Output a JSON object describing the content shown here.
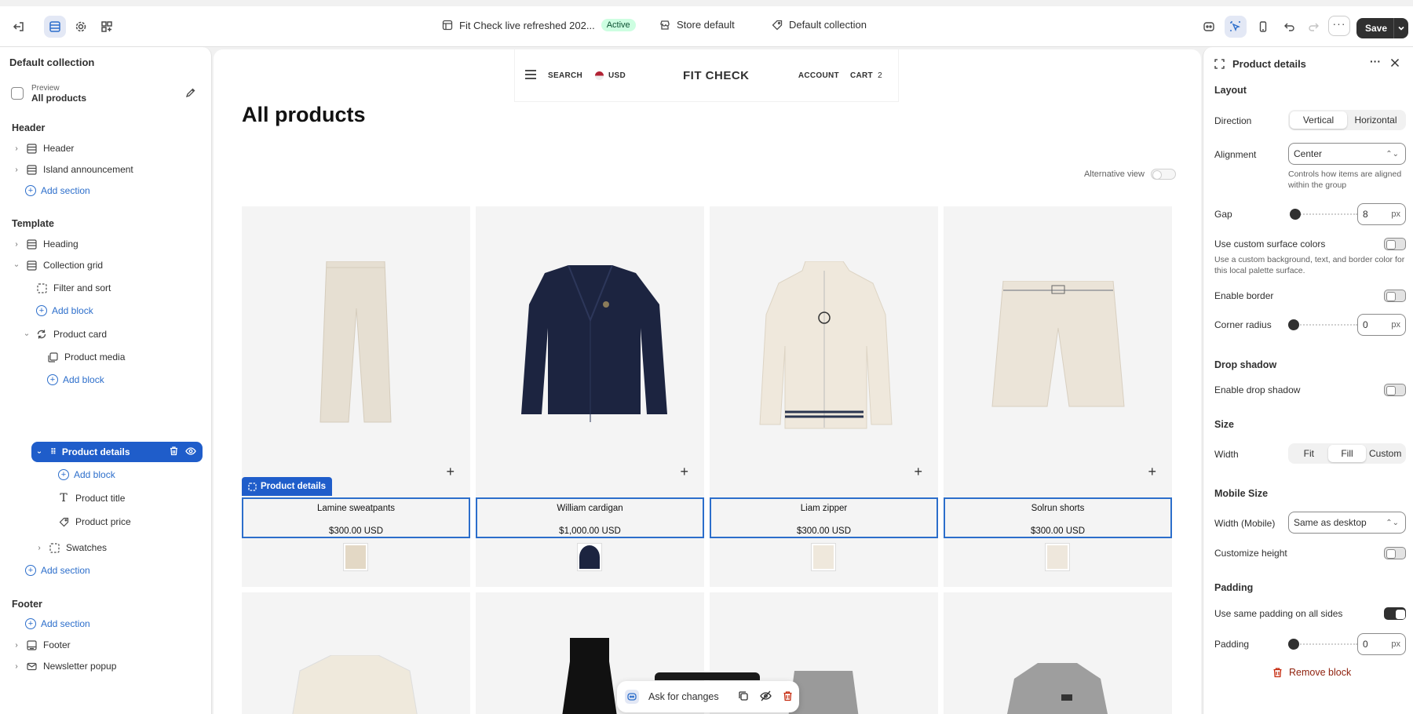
{
  "topbar": {
    "theme_name": "Fit Check live refreshed 202...",
    "theme_status": "Active",
    "store": "Store default",
    "template": "Default collection",
    "save_label": "Save"
  },
  "sidebar": {
    "title": "Default collection",
    "preview_label": "Preview",
    "preview_value": "All products",
    "groups": {
      "header": "Header",
      "template": "Template",
      "footer": "Footer"
    },
    "items": {
      "header": "Header",
      "island": "Island announcement",
      "add_section": "Add section",
      "heading": "Heading",
      "collection_grid": "Collection grid",
      "filter_sort": "Filter and sort",
      "add_block": "Add block",
      "product_card": "Product card",
      "product_media": "Product media",
      "product_details": "Product details",
      "product_title": "Product title",
      "product_price": "Product price",
      "swatches": "Swatches",
      "footer": "Footer",
      "newsletter": "Newsletter popup"
    }
  },
  "store": {
    "search": "SEARCH",
    "currency": "USD",
    "brand": "FIT CHECK",
    "account": "ACCOUNT",
    "cart": "CART",
    "cart_count": "2",
    "page_title": "All products",
    "alt_view": "Alternative view",
    "details_tag": "Product details",
    "products": [
      {
        "title": "Lamine sweatpants",
        "price": "$300.00 USD",
        "swatch": "#e3d8c5",
        "color": "#e6dfd2"
      },
      {
        "title": "William cardigan",
        "price": "$1,000.00 USD",
        "swatch": "#1c2440",
        "color": "#1c2440"
      },
      {
        "title": "Liam zipper",
        "price": "$300.00 USD",
        "swatch": "#efe8dc",
        "color": "#efe8dc"
      },
      {
        "title": "Solrun shorts",
        "price": "$300.00 USD",
        "swatch": "#eee7dc",
        "color": "#ebe4d8"
      }
    ],
    "ask": "Ask for changes"
  },
  "panel": {
    "title": "Product details",
    "layout": "Layout",
    "direction": "Direction",
    "dir_opts": [
      "Vertical",
      "Horizontal"
    ],
    "alignment": "Alignment",
    "alignment_value": "Center",
    "alignment_help": "Controls how items are aligned within the group",
    "gap": "Gap",
    "gap_value": "8",
    "unit": "px",
    "custom_surface": "Use custom surface colors",
    "custom_surface_help": "Use a custom background, text, and border color for this local palette surface.",
    "enable_border": "Enable border",
    "corner_radius": "Corner radius",
    "corner_value": "0",
    "drop_shadow": "Drop shadow",
    "enable_drop_shadow": "Enable drop shadow",
    "size": "Size",
    "width": "Width",
    "width_opts": [
      "Fit",
      "Fill",
      "Custom"
    ],
    "mobile_size": "Mobile Size",
    "width_mobile": "Width (Mobile)",
    "width_mobile_value": "Same as desktop",
    "customize_height": "Customize height",
    "padding_sec": "Padding",
    "same_padding": "Use same padding on all sides",
    "padding": "Padding",
    "padding_value": "0",
    "remove": "Remove block"
  }
}
